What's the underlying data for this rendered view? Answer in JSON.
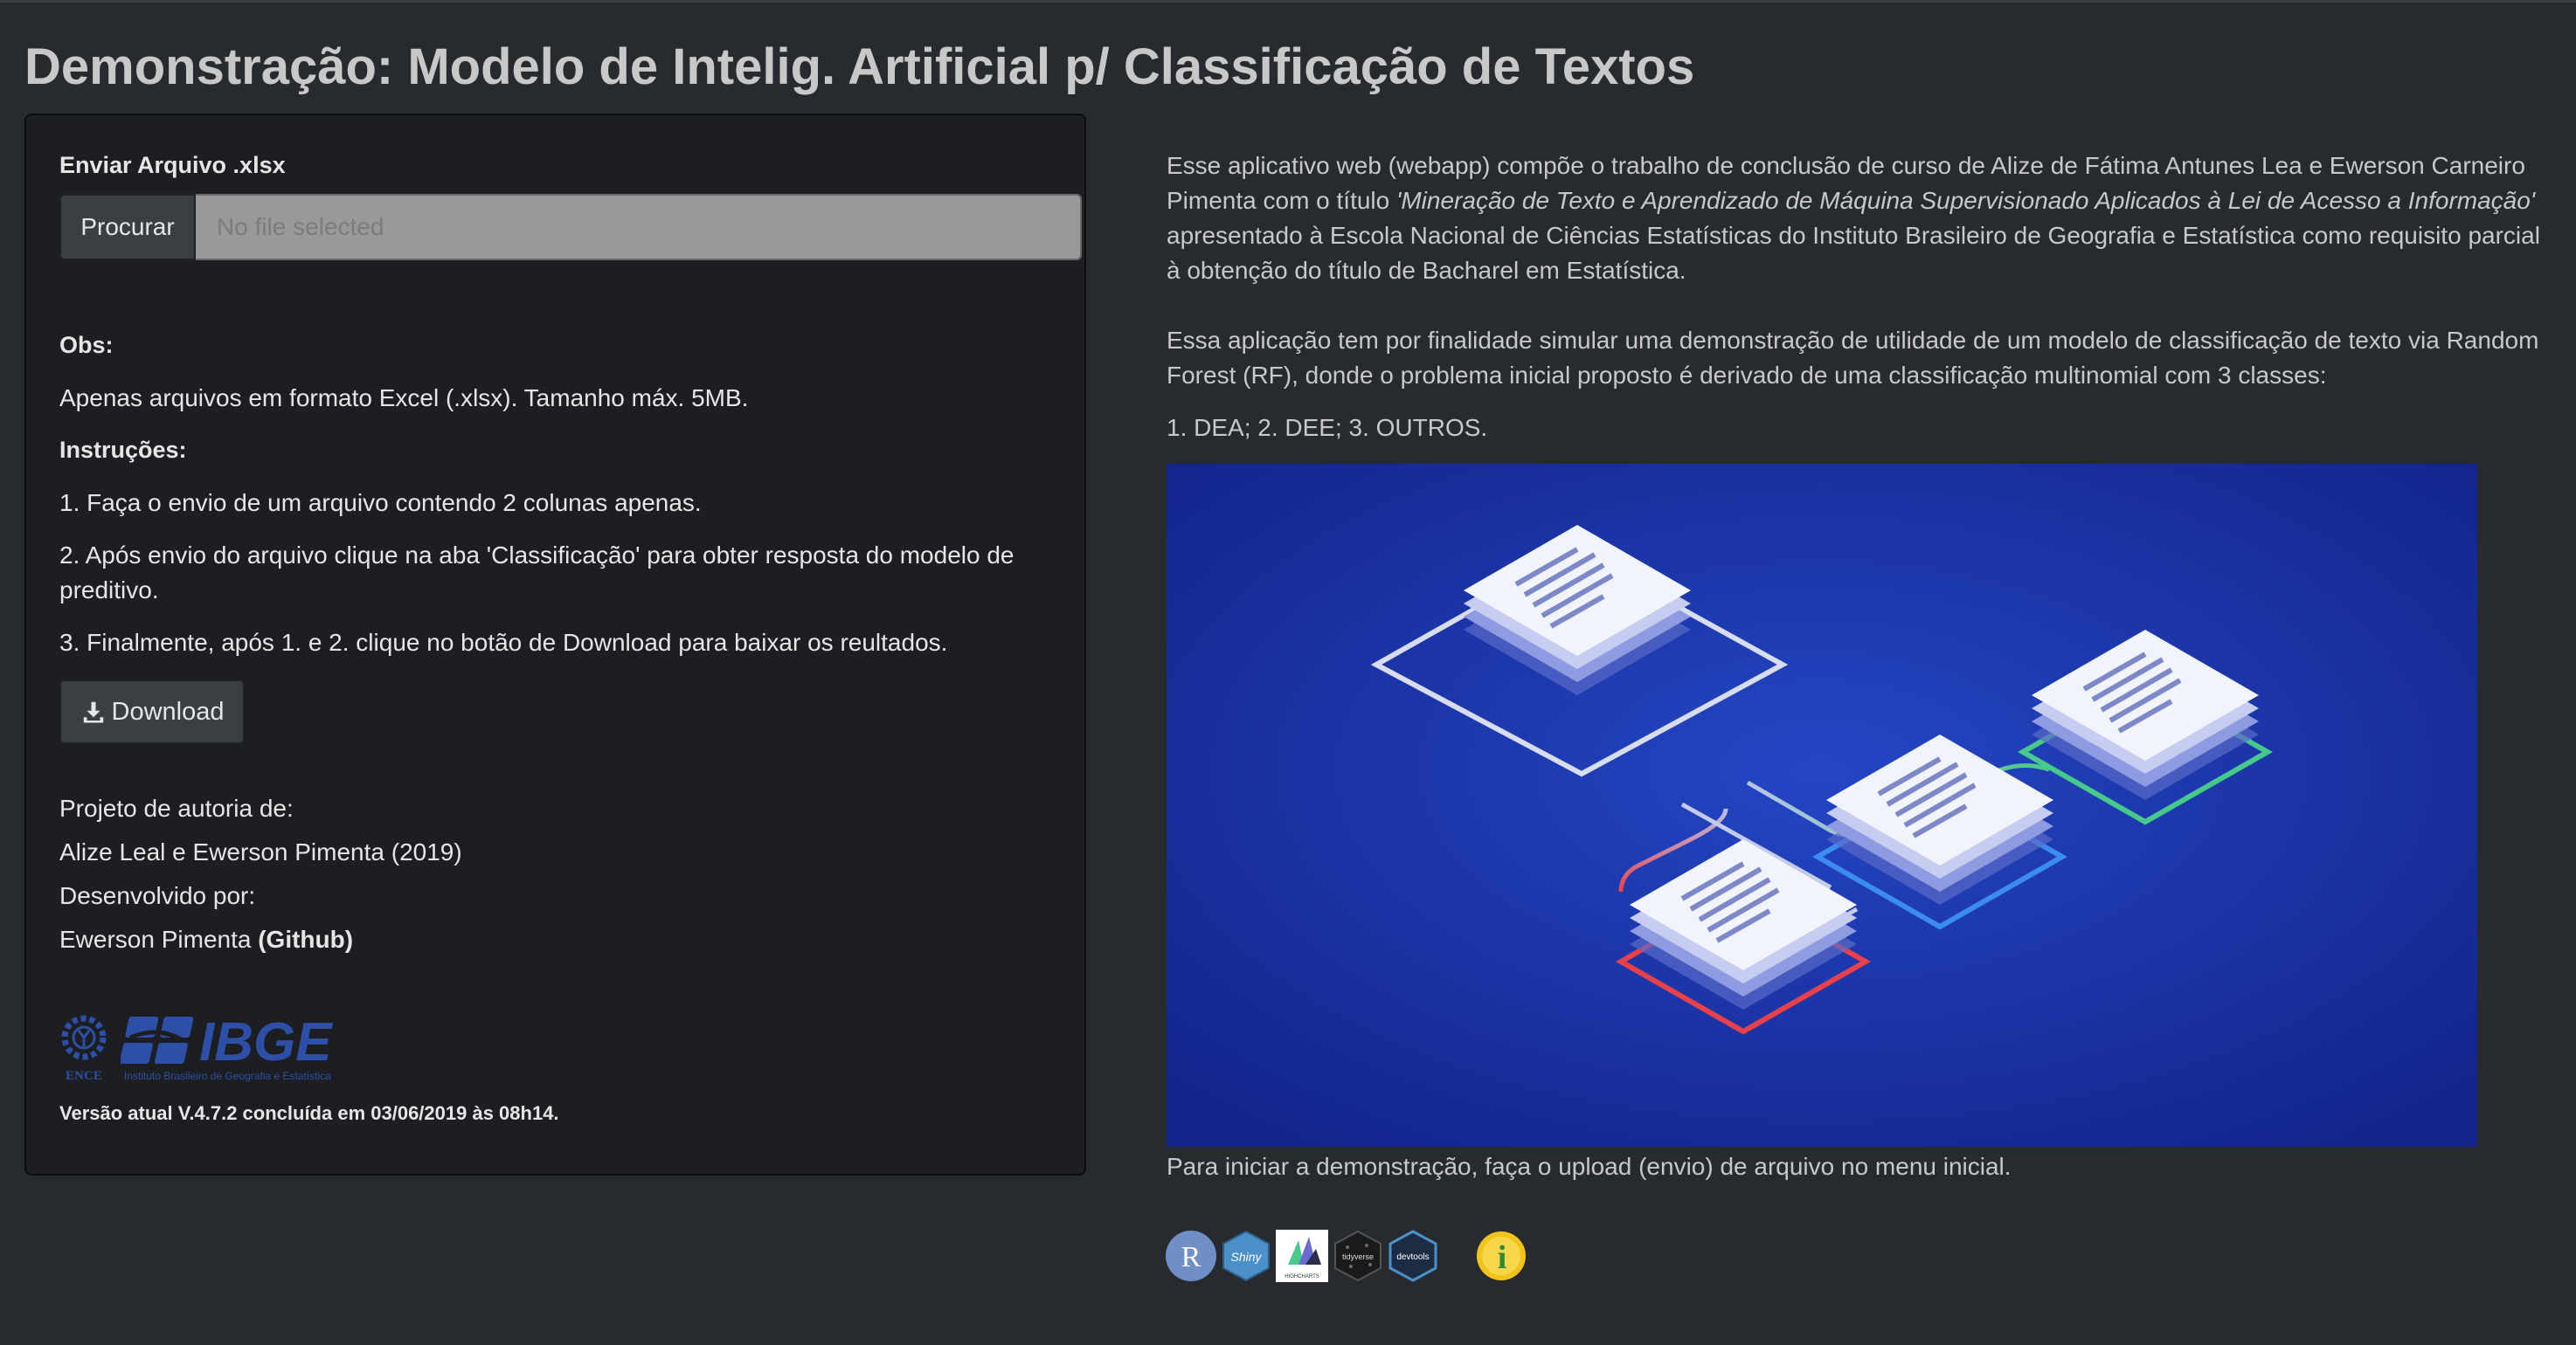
{
  "page": {
    "title": "Demonstração: Modelo de Intelig. Artificial p/ Classificação de Textos"
  },
  "sidebar": {
    "upload_label": "Enviar Arquivo .xlsx",
    "browse_button": "Procurar",
    "file_placeholder": "No file selected",
    "obs_heading": "Obs:",
    "obs_text": "Apenas arquivos em formato Excel (.xlsx). Tamanho máx. 5MB.",
    "instructions_heading": "Instruções:",
    "instructions": [
      "1. Faça o envio de um arquivo contendo 2 colunas apenas.",
      "2. Após envio do arquivo clique na aba 'Classificação' para obter resposta do modelo de",
      "preditivo.",
      "3. Finalmente, após 1. e 2. clique no botão de Download para baixar os reultados."
    ],
    "download_button": "Download",
    "authorship_heading": "Projeto de autoria de:",
    "authors": "Alize Leal e Ewerson Pimenta (2019)",
    "developed_heading": "Desenvolvido por:",
    "developer_name": "Ewerson Pimenta",
    "developer_link": "(Github)",
    "logo_ence_text": "ENCE",
    "logo_ibge_text": "IBGE",
    "logo_ibge_subtitle": "Instituto Brasileiro de Geografia e Estatística",
    "version": "Versão atual V.4.7.2 concluída em 03/06/2019 às 08h14."
  },
  "main": {
    "para1_line1": "Esse aplicativo web (webapp) compõe o trabalho de conclusão de curso de Alize de Fátima Antunes Lea e Ewerson Carneiro",
    "para1_line2_a": "Pimenta com o título ",
    "para1_line2_italic": "'Mineração de Texto e Aprendizado de Máquina Supervisionado Aplicados à Lei de Acesso a Informação'",
    "para1_line3": "apresentado à Escola Nacional de Ciências Estatísticas do Instituto Brasileiro de Geografia e Estatística como requisito parcial",
    "para1_line4": "à obtenção do título de Bacharel em Estatística.",
    "para2_line1": "Essa aplicação tem por finalidade simular uma demonstração de utilidade de um modelo de classificação de texto via Random",
    "para2_line2": "Forest (RF), donde o problema inicial proposto é derivado de uma classificação multinomial com 3 classes:",
    "classes": "1. DEA; 2. DEE; 3. OUTROS.",
    "footer_text": "Para iniciar a demonstração, faça o upload (envio) de arquivo no menu inicial.",
    "badges": [
      "R",
      "Shiny",
      "HIGHCHARTS",
      "tidyverse",
      "devtools",
      "i"
    ]
  },
  "colors": {
    "background": "#272b30",
    "panel": "#1c1e22",
    "hero_blue": "#1b2f9a",
    "red": "#e8414b",
    "blue": "#3b8bf0",
    "green": "#46c98a"
  }
}
